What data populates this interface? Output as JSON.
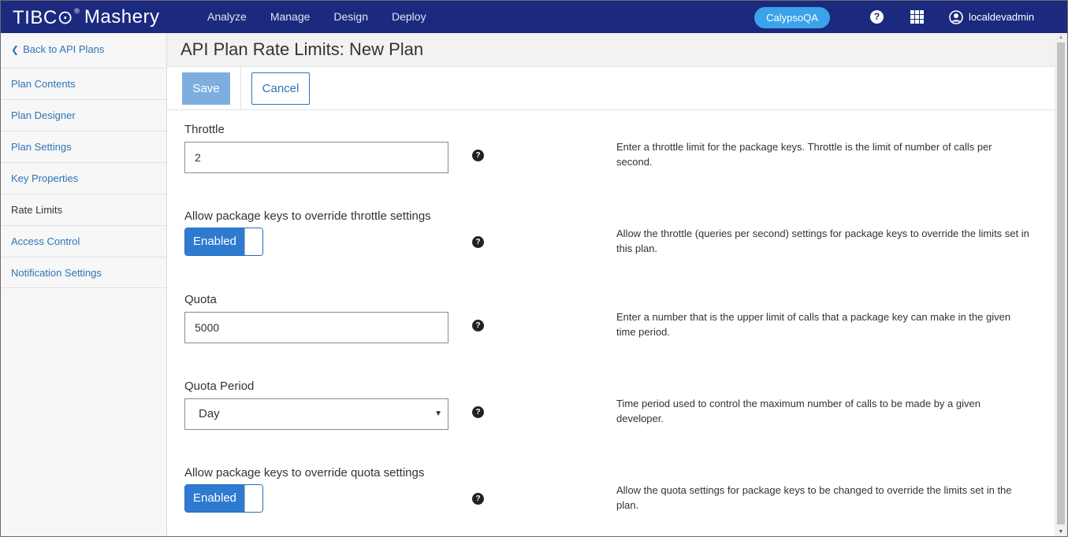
{
  "app": {
    "brand_tibco": "TIBC⊙",
    "brand_reg": "®",
    "brand_product": "Mashery"
  },
  "nav": [
    "Analyze",
    "Manage",
    "Design",
    "Deploy"
  ],
  "environment": "CalypsoQA",
  "help_glyph": "?",
  "user": {
    "name": "localdevadmin",
    "icon": "user-circle-icon"
  },
  "sidebar": {
    "back_label": "Back to API Plans",
    "back_icon": "chevron-left-icon",
    "items": [
      {
        "label": "Plan Contents",
        "active": false
      },
      {
        "label": "Plan Designer",
        "active": false
      },
      {
        "label": "Plan Settings",
        "active": false
      },
      {
        "label": "Key Properties",
        "active": false
      },
      {
        "label": "Rate Limits",
        "active": true
      },
      {
        "label": "Access Control",
        "active": false
      },
      {
        "label": "Notification Settings",
        "active": false
      }
    ]
  },
  "page": {
    "title": "API Plan Rate Limits: New Plan"
  },
  "toolbar": {
    "save_label": "Save",
    "cancel_label": "Cancel"
  },
  "form": {
    "throttle": {
      "label": "Throttle",
      "value": "2",
      "help": "Enter a throttle limit for the package keys. Throttle is the limit of number of calls per second."
    },
    "override_throttle": {
      "label": "Allow package keys to override throttle settings",
      "state": "Enabled",
      "help": "Allow the throttle (queries per second) settings for package keys to override the limits set in this plan."
    },
    "quota": {
      "label": "Quota",
      "value": "5000",
      "help": "Enter a number that is the upper limit of calls that a package key can make in the given time period."
    },
    "quota_period": {
      "label": "Quota Period",
      "value": "Day",
      "help": "Time period used to control the maximum number of calls to be made by a given developer."
    },
    "override_quota": {
      "label": "Allow package keys to override quota settings",
      "state": "Enabled",
      "help": "Allow the quota settings for package keys to be changed to override the limits set in the plan."
    }
  },
  "colors": {
    "topbar": "#1b2a7f",
    "accent": "#2f73b8",
    "env_pill": "#3ba3ea",
    "toggle_on": "#2e7ad1",
    "save_disabled": "#7eaee0"
  }
}
